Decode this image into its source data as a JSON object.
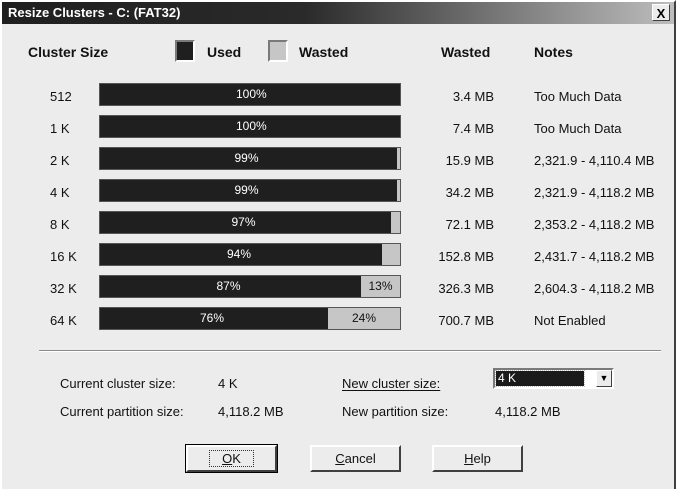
{
  "window": {
    "title": "Resize Clusters - C:  (FAT32)",
    "close_label": "X"
  },
  "header": {
    "cluster_size": "Cluster Size",
    "used": "Used",
    "wasted": "Wasted",
    "wasted_col": "Wasted",
    "notes": "Notes"
  },
  "colors": {
    "used": "#1f1f1f",
    "wasted": "#c6c6c6"
  },
  "rows": [
    {
      "size": "512",
      "used_pct": "100%",
      "used_fraction": 1.0,
      "waste_pct": "",
      "wasted": "3.4 MB",
      "note": "Too Much Data"
    },
    {
      "size": "1 K",
      "used_pct": "100%",
      "used_fraction": 1.0,
      "waste_pct": "",
      "wasted": "7.4 MB",
      "note": "Too Much Data"
    },
    {
      "size": "2 K",
      "used_pct": "99%",
      "used_fraction": 0.99,
      "waste_pct": "",
      "wasted": "15.9 MB",
      "note": "2,321.9 - 4,110.4 MB"
    },
    {
      "size": "4 K",
      "used_pct": "99%",
      "used_fraction": 0.99,
      "waste_pct": "",
      "wasted": "34.2 MB",
      "note": "2,321.9 - 4,118.2 MB"
    },
    {
      "size": "8 K",
      "used_pct": "97%",
      "used_fraction": 0.97,
      "waste_pct": "",
      "wasted": "72.1 MB",
      "note": "2,353.2 - 4,118.2 MB"
    },
    {
      "size": "16 K",
      "used_pct": "94%",
      "used_fraction": 0.94,
      "waste_pct": "",
      "wasted": "152.8 MB",
      "note": "2,431.7 - 4,118.2 MB"
    },
    {
      "size": "32 K",
      "used_pct": "87%",
      "used_fraction": 0.87,
      "waste_pct": "13%",
      "wasted": "326.3 MB",
      "note": "2,604.3 - 4,118.2 MB"
    },
    {
      "size": "64 K",
      "used_pct": "76%",
      "used_fraction": 0.76,
      "waste_pct": "24%",
      "wasted": "700.7 MB",
      "note": "Not Enabled"
    }
  ],
  "info": {
    "current_cluster_label": "Current cluster size:",
    "current_cluster_value": "4 K",
    "current_partition_label": "Current partition size:",
    "current_partition_value": "4,118.2 MB",
    "new_cluster_label": "New cluster size:",
    "new_cluster_value": "4 K",
    "new_partition_label": "New partition size:",
    "new_partition_value": "4,118.2 MB"
  },
  "buttons": {
    "ok": "OK",
    "cancel": "Cancel",
    "help": "Help"
  }
}
